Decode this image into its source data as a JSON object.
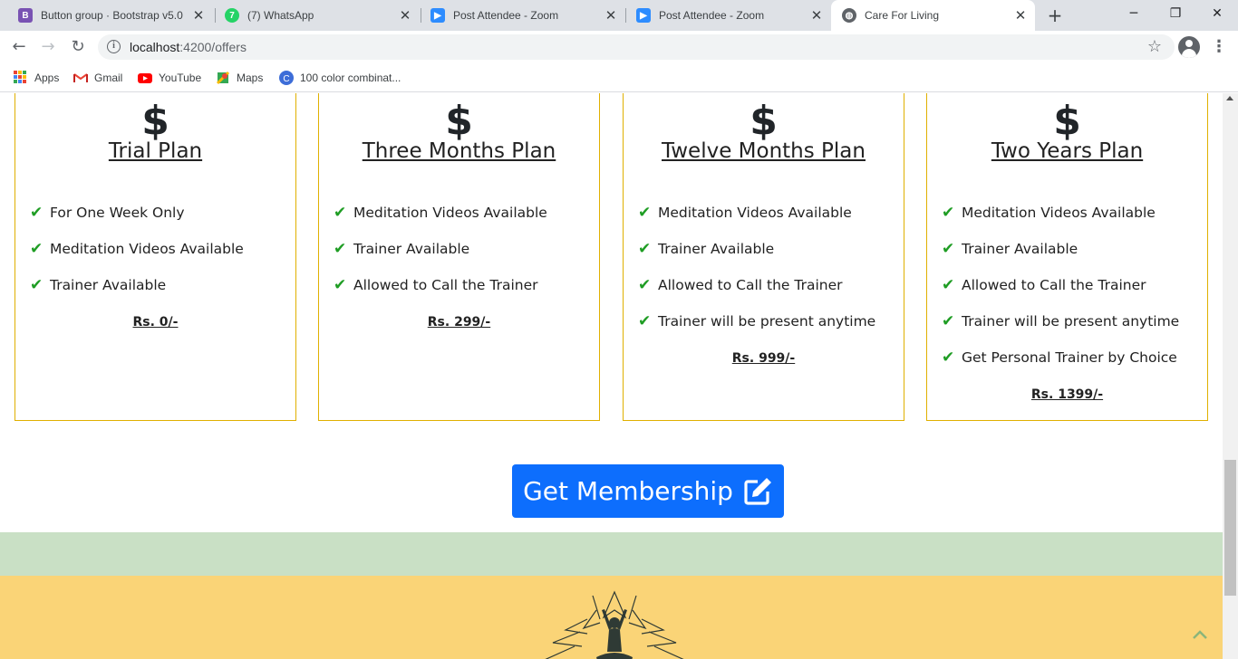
{
  "browser": {
    "tabs": [
      {
        "title": "Button group · Bootstrap v5.0",
        "icon": "bootstrap-icon",
        "color": "#7952b3"
      },
      {
        "title": "(7) WhatsApp",
        "icon": "whatsapp-icon",
        "color": "#25d366"
      },
      {
        "title": "Post Attendee - Zoom",
        "icon": "zoom-icon",
        "color": "#2d8cff"
      },
      {
        "title": "Post Attendee - Zoom",
        "icon": "zoom-icon",
        "color": "#2d8cff"
      },
      {
        "title": "Care For Living",
        "icon": "globe-icon",
        "color": "#5f6368",
        "active": true
      }
    ],
    "url_host": "localhost",
    "url_path": ":4200/offers",
    "bookmarks": [
      {
        "label": "Apps",
        "icon": "apps-grid-icon"
      },
      {
        "label": "Gmail",
        "icon": "gmail-icon"
      },
      {
        "label": "YouTube",
        "icon": "youtube-icon"
      },
      {
        "label": "Maps",
        "icon": "maps-icon"
      },
      {
        "label": "100 color combinat...",
        "icon": "canva-icon"
      }
    ]
  },
  "plans": [
    {
      "title": "Trial Plan",
      "features": [
        "For One Week Only",
        "Meditation Videos Available",
        "Trainer Available"
      ],
      "price": "Rs. 0/-"
    },
    {
      "title": "Three Months Plan",
      "features": [
        "Meditation Videos Available",
        "Trainer Available",
        "Allowed to Call the Trainer"
      ],
      "price": "Rs. 299/-"
    },
    {
      "title": "Twelve Months Plan",
      "features": [
        "Meditation Videos Available",
        "Trainer Available",
        "Allowed to Call the Trainer",
        "Trainer will be present anytime"
      ],
      "price": "Rs. 999/-"
    },
    {
      "title": "Two Years Plan",
      "features": [
        "Meditation Videos Available",
        "Trainer Available",
        "Allowed to Call the Trainer",
        "Trainer will be present anytime",
        "Get Personal Trainer by Choice"
      ],
      "price": "Rs. 1399/-"
    }
  ],
  "plan_icon": "dollar-sign",
  "cta": {
    "label": "Get Membership",
    "icon": "edit-icon"
  },
  "colors": {
    "card_border": "#e0b000",
    "check": "#1f9d24",
    "cta_bg": "#0d6efd",
    "band_green": "#c9e0c5",
    "band_yellow": "#fad477"
  }
}
